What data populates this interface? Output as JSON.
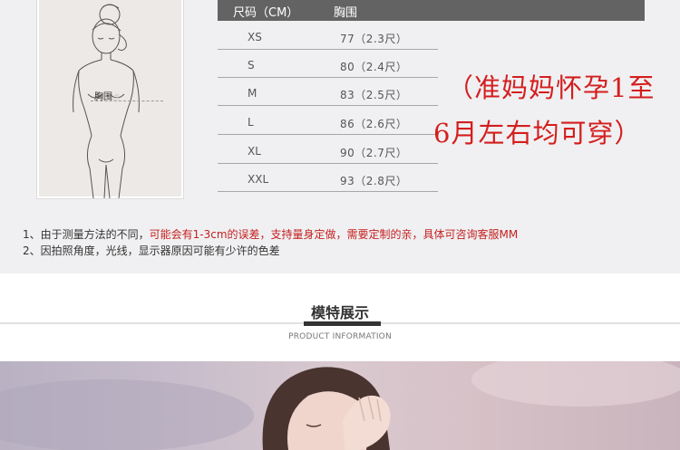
{
  "size_chart": {
    "header": {
      "size": "尺码（CM）",
      "bust": "胸围"
    },
    "rows": [
      {
        "size": "XS",
        "bust": "77（2.3尺）"
      },
      {
        "size": "S",
        "bust": "80（2.4尺）"
      },
      {
        "size": "M",
        "bust": "83（2.5尺）"
      },
      {
        "size": "L",
        "bust": "86（2.6尺）"
      },
      {
        "size": "XL",
        "bust": "90（2.7尺）"
      },
      {
        "size": "XXL",
        "bust": "93（2.8尺）"
      }
    ]
  },
  "sketch": {
    "bust_label": "胸围",
    "bust_dot": "点"
  },
  "handwritten_note": {
    "line1": "（准妈妈怀孕1至",
    "line2": "6月左右均可穿）"
  },
  "notes": {
    "note1_prefix": "1、由于测量方法的不同，",
    "note1_red": "可能会有1-3cm的误差，支持量身定做，需要定制的亲，具体可咨询客服MM",
    "note2": "2、因拍照角度，光线，显示器原因可能有少许的色差"
  },
  "section": {
    "title": "模特展示",
    "subtitle": "PRODUCT INFORMATION"
  },
  "colors": {
    "header_bg": "#636363",
    "red": "#c51f1f",
    "handwriting": "#d41e1e"
  }
}
